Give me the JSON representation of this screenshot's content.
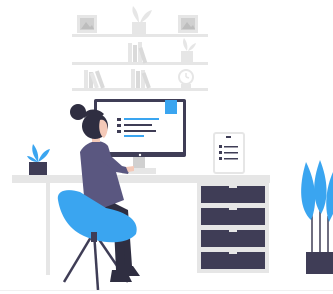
{
  "illustration": {
    "colors": {
      "accent": "#3AA5F0",
      "dark": "#3F3D56",
      "shirt": "#5A5780",
      "skin": "#F4C9B8",
      "hair": "#2F2E41",
      "light_gray": "#E6E6E6",
      "mid_gray": "#D0D0D0",
      "white": "#FFFFFF"
    },
    "icons": [
      "framed-picture-icon",
      "books-icon",
      "potted-plant-icon",
      "clock-icon",
      "document-list-icon"
    ]
  }
}
